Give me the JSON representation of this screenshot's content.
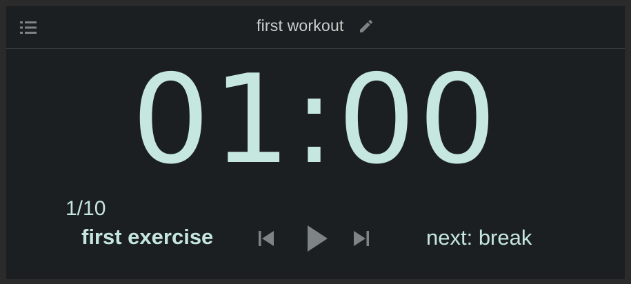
{
  "header": {
    "menu_icon": "list-menu-icon",
    "title": "first workout",
    "edit_icon": "pencil-edit-icon"
  },
  "timer": {
    "display": "01:00"
  },
  "progress": {
    "counter": "1/10",
    "exercise_name": "first exercise",
    "next_label": "next: break"
  },
  "controls": {
    "previous_icon": "skip-previous-icon",
    "play_icon": "play-icon",
    "next_icon": "skip-next-icon"
  },
  "colors": {
    "background": "#1c1f22",
    "frame": "#2b2b2b",
    "accent_text": "#c5e7e0",
    "title_text": "#c9cfcd",
    "icon": "#7e8486"
  }
}
